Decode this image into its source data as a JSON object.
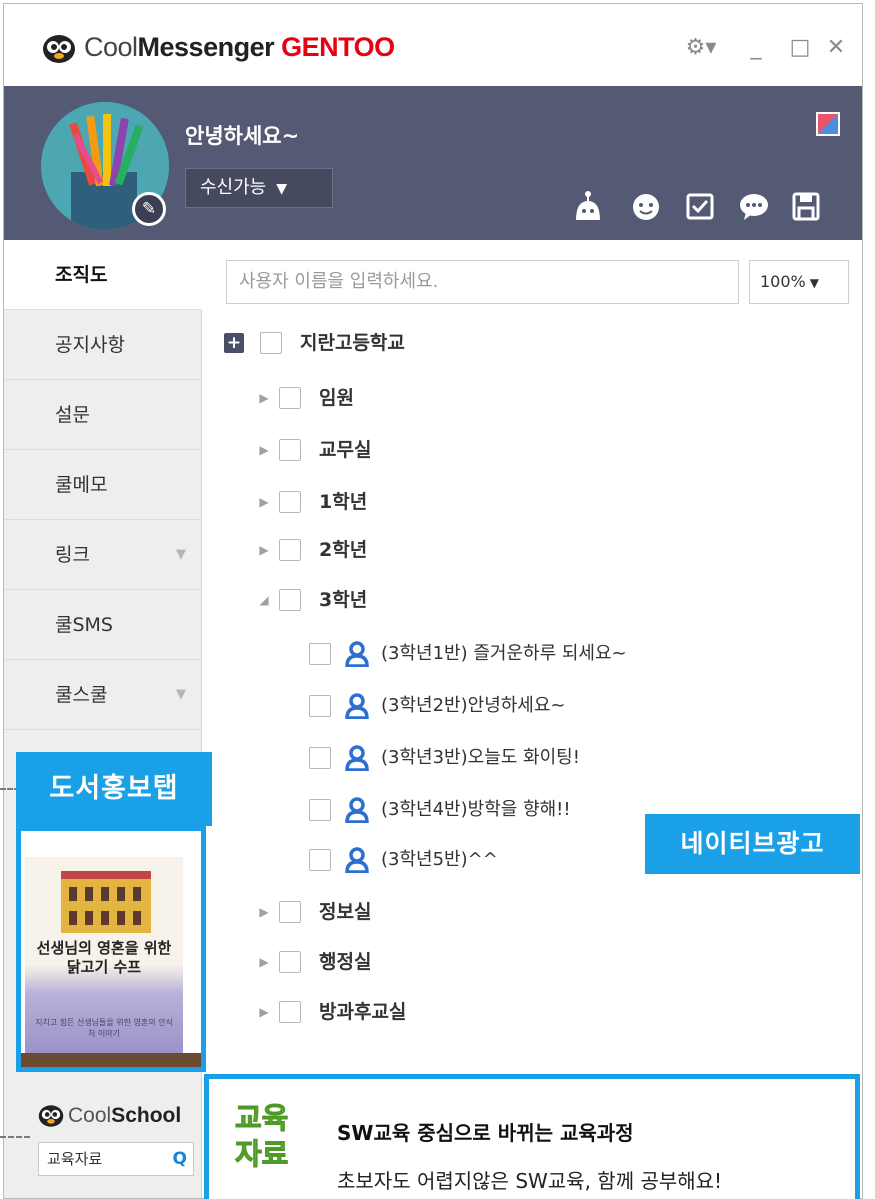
{
  "app": {
    "title_part1": "Cool",
    "title_part2": "Messenger",
    "title_part3": "GENTOO"
  },
  "window_controls": {
    "settings": "⚙▾",
    "minimize": "_",
    "maximize": "□",
    "close": "✕"
  },
  "profile": {
    "greeting": "안녕하세요~",
    "status": "수신가능",
    "status_caret": "▼"
  },
  "sidebar": {
    "items": [
      {
        "label": "조직도",
        "arrow": ""
      },
      {
        "label": "공지사항",
        "arrow": ""
      },
      {
        "label": "설문",
        "arrow": ""
      },
      {
        "label": "쿨메모",
        "arrow": ""
      },
      {
        "label": "링크",
        "arrow": "▼"
      },
      {
        "label": "쿨SMS",
        "arrow": ""
      },
      {
        "label": "쿨스쿨",
        "arrow": "▼"
      }
    ],
    "book_tab_label": "도서홍보탭",
    "book": {
      "title_line1": "선생님의 영혼을 위한",
      "title_line2": "닭고기 수프",
      "subtitle": "지치고 힘든 선생님들을 위한 영혼의 안식처 이야기"
    },
    "coolschool": {
      "title_a": "Cool",
      "title_b": "School",
      "search_text": "교육자료",
      "search_icon": "Q"
    }
  },
  "main": {
    "search_placeholder": "사용자 이름을 입력하세요.",
    "zoom": "100%",
    "zoom_caret": "▼",
    "root": {
      "label": "지란고등학교",
      "expander": "+"
    },
    "groups_top": [
      {
        "label": "임원",
        "expander": "▶"
      },
      {
        "label": "교무실",
        "expander": "▶"
      },
      {
        "label": "1학년",
        "expander": "▶"
      },
      {
        "label": "2학년",
        "expander": "▶"
      },
      {
        "label": "3학년",
        "expander": "◢"
      }
    ],
    "members": [
      {
        "label": "(3학년1반) 즐거운하루 되세요~"
      },
      {
        "label": "(3학년2반)안녕하세요~"
      },
      {
        "label": "(3학년3반)오늘도 화이팅!"
      },
      {
        "label": "(3학년4반)방학을 향해!!"
      },
      {
        "label": "(3학년5반)^^"
      }
    ],
    "groups_bottom": [
      {
        "label": "정보실",
        "expander": "▶"
      },
      {
        "label": "행정실",
        "expander": "▶"
      },
      {
        "label": "방과후교실",
        "expander": "▶"
      }
    ]
  },
  "ad": {
    "section_label": "네이티브광고",
    "badge_line1": "교육",
    "badge_line2": "자료",
    "title": "SW교육 중심으로 바뀌는 교육과정",
    "description": "초보자도 어렵지않은 SW교육, 함께 공부해요!"
  },
  "colors": {
    "accent": "#1aa0e6",
    "header_bg": "#545a73",
    "brand_red": "#e60012"
  }
}
